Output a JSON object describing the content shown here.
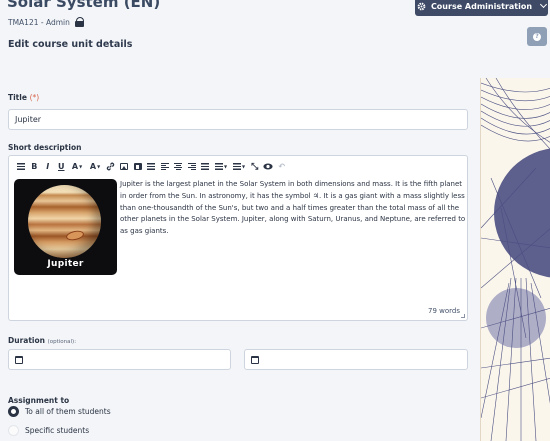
{
  "header": {
    "course_title": "Solar System (EN)",
    "course_code": "TMA121 - Admin",
    "admin_button_label": "Course Administration",
    "page_heading": "Edit course unit details",
    "help_symbol": "?"
  },
  "form": {
    "title_label": "Title",
    "title_required_mark": "(*)",
    "title_value": "Jupiter",
    "short_description_label": "Short description",
    "toolbar": {
      "bold": "B",
      "italic": "I",
      "underline": "U",
      "font_color": "A",
      "bg_color": "A",
      "link": "🔗",
      "fullscreen": "⤡",
      "preview": "👁",
      "undo": "↶"
    },
    "image_caption": "Jupiter",
    "description_text": "Jupiter is the largest planet in the Solar System in both dimensions and mass. It is the fifth planet in order from the Sun. In astronomy, it has the symbol ♃. It is a gas giant with a mass slightly less than one-thousandth of the Sun's, but two and a half times greater than the total mass of all the other planets in the Solar System. Jupiter, along with Saturn, Uranus, and Neptune, are referred to as gas giants.",
    "word_count": "79 words",
    "duration_label": "Duration",
    "duration_optional": "(optional):",
    "duration_start_value": "",
    "duration_end_value": "",
    "assignment_label": "Assignment to",
    "assignment_options": [
      {
        "label": "To all of them students",
        "selected": true
      },
      {
        "label": "Specific students",
        "selected": false
      }
    ]
  },
  "colors": {
    "accent": "#3e4a66",
    "required": "#d9624a",
    "help_button": "#8f9fb6"
  }
}
